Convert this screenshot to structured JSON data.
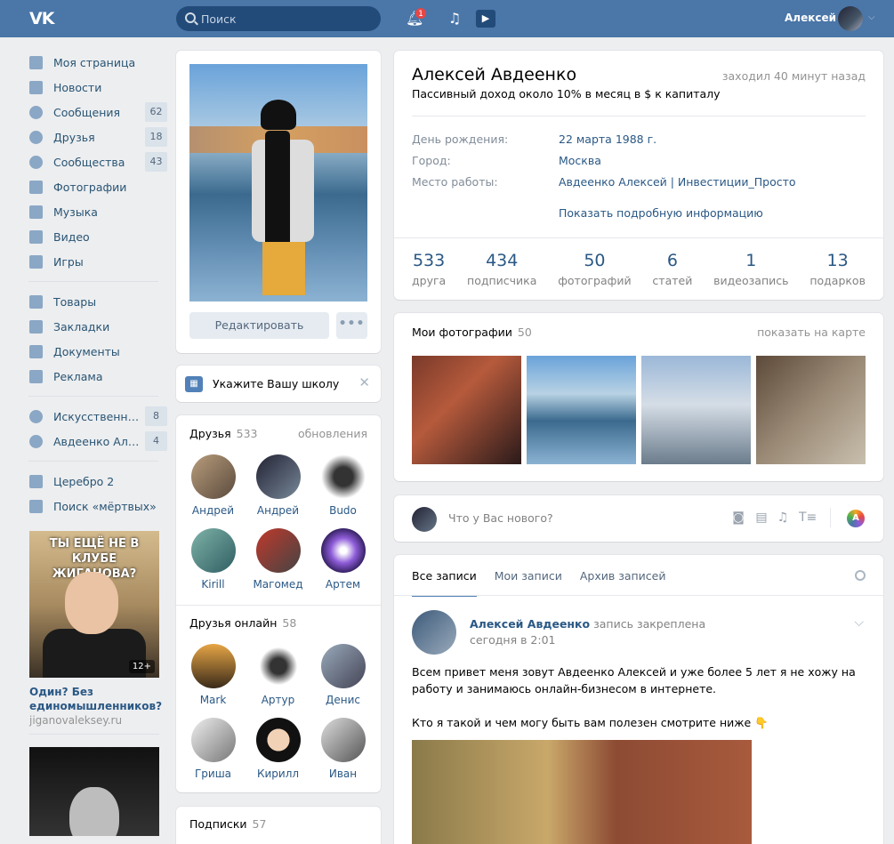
{
  "header": {
    "logo": "VK",
    "search_placeholder": "Поиск",
    "notifications_count": "1",
    "user_name": "Алексей"
  },
  "sidebar": {
    "items": [
      {
        "label": "Моя страница",
        "icon": "home-icon",
        "count": ""
      },
      {
        "label": "Новости",
        "icon": "news-icon",
        "count": ""
      },
      {
        "label": "Сообщения",
        "icon": "message-icon",
        "count": "62"
      },
      {
        "label": "Друзья",
        "icon": "user-icon",
        "count": "18"
      },
      {
        "label": "Сообщества",
        "icon": "group-icon",
        "count": "43"
      },
      {
        "label": "Фотографии",
        "icon": "camera-icon",
        "count": ""
      },
      {
        "label": "Музыка",
        "icon": "music-icon",
        "count": ""
      },
      {
        "label": "Видео",
        "icon": "video-icon",
        "count": ""
      },
      {
        "label": "Игры",
        "icon": "gamepad-icon",
        "count": ""
      }
    ],
    "items2": [
      {
        "label": "Товары",
        "icon": "bag-icon"
      },
      {
        "label": "Закладки",
        "icon": "star-icon"
      },
      {
        "label": "Документы",
        "icon": "document-icon"
      },
      {
        "label": "Реклама",
        "icon": "megaphone-icon"
      }
    ],
    "groups": [
      {
        "label": "Искусственные...",
        "count": "8"
      },
      {
        "label": "Авдеенко Алек...",
        "count": "4"
      }
    ],
    "apps": [
      {
        "label": "Церебро 2"
      },
      {
        "label": "Поиск «мёртвых»"
      }
    ],
    "ad": {
      "image_text": "ТЫ ЕЩЁ НЕ В КЛУБЕ ЖИГАНОВА?",
      "age": "12+",
      "title": "Один? Без единомышленников?",
      "url": "jiganovaleksey.ru"
    }
  },
  "left_column": {
    "edit_button": "Редактировать",
    "more_button": "•••",
    "school_prompt": "Укажите Вашу школу",
    "friends_title": "Друзья",
    "friends_count": "533",
    "friends_updates": "обновления",
    "friends": [
      "Андрей",
      "Андрей",
      "Budo",
      "Kirill",
      "Магомед",
      "Артем"
    ],
    "online_title": "Друзья онлайн",
    "online_count": "58",
    "online": [
      "Mark",
      "Артур",
      "Денис",
      "Гриша",
      "Кирилл",
      "Иван"
    ],
    "subs_title": "Подписки",
    "subs_count": "57"
  },
  "profile": {
    "name": "Алексей Авдеенко",
    "last_seen": "заходил 40 минут назад",
    "status": "Пассивный доход около 10% в месяц в $ к капиталу",
    "birthday_label": "День рождения:",
    "birthday": "22 марта 1988 г.",
    "city_label": "Город:",
    "city": "Москва",
    "work_label": "Место работы:",
    "work": "Авдеенко Алексей | Инвестиции_Просто",
    "more_info": "Показать подробную информацию",
    "counters": [
      {
        "n": "533",
        "l": "друга"
      },
      {
        "n": "434",
        "l": "подписчика"
      },
      {
        "n": "50",
        "l": "фотографий"
      },
      {
        "n": "6",
        "l": "статей"
      },
      {
        "n": "1",
        "l": "видеозапись"
      },
      {
        "n": "13",
        "l": "подарков"
      }
    ]
  },
  "photos": {
    "title": "Мои фотографии",
    "count": "50",
    "map_link": "показать на карте"
  },
  "composer": {
    "placeholder": "Что у Вас нового?"
  },
  "wall": {
    "tabs": [
      "Все записи",
      "Мои записи",
      "Архив записей"
    ],
    "post": {
      "author": "Алексей Авдеенко",
      "pinned": "запись закреплена",
      "time": "сегодня в 2:01",
      "text1": "Всем привет меня зовут Авдеенко Алексей и уже более 5 лет я не хожу на работу и занимаюсь онлайн-бизнесом в интернете.",
      "text2": "Кто я такой и чем могу быть вам полезен смотрите ниже 👇"
    }
  },
  "colors": {
    "header": "#4a76a8",
    "link": "#2a5885",
    "background": "#edeef0"
  }
}
